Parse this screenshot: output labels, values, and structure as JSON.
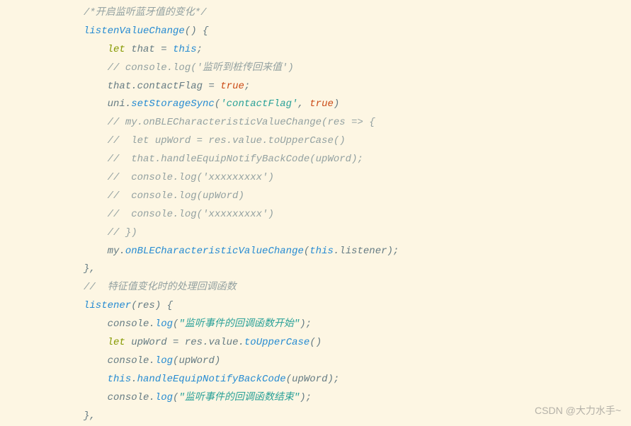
{
  "code": {
    "c1": "/*开启监听蓝牙值的变化*/",
    "fn_def": "listenValueChange",
    "paren_open": "() {",
    "let1": "let",
    "that": " that ",
    "eq": "= ",
    "this1": "this",
    "semi": ";",
    "c2": "// console.log('监听到桩传回来值')",
    "thatdot": "that.",
    "contactFlag": "contactFlag",
    "eqsp": " = ",
    "true1": "true",
    "uni": "uni.",
    "setStorageSync": "setStorageSync",
    "lp": "(",
    "str_contactFlag": "'contactFlag'",
    "comma": ", ",
    "rp": ")",
    "c3": "// my.onBLECharacteristicValueChange(res => {",
    "c4": "//  let upWord = res.value.toUpperCase()",
    "c5": "//  that.handleEquipNotifyBackCode(upWord);",
    "c6": "//  console.log('xxxxxxxxx')",
    "c7": "//  console.log(upWord)",
    "c8": "//  console.log('xxxxxxxxx')",
    "c9": "// })",
    "my": "my.",
    "onBLE": "onBLECharacteristicValueChange",
    "thisdot": "this",
    "dot": ".",
    "listener_ref": "listener",
    "brace_close_comma": "},",
    "c10": "//  特征值变化时的处理回调函数",
    "listener_def": "listener",
    "res_param": "(res) {",
    "console": "console.",
    "log": "log",
    "str_start": "\"监听事件的回调函数开始\"",
    "let2": "let",
    "upWord": " upWord ",
    "resdot": "res.",
    "value": "value",
    "toUpperCase": "toUpperCase",
    "empty_call": "()",
    "upWord_arg": "upWord",
    "handleEquip": "handleEquipNotifyBackCode",
    "str_end": "\"监听事件的回调函数结束\"",
    "brace_close_comma2": "},"
  },
  "watermark": "CSDN @大力水手~"
}
